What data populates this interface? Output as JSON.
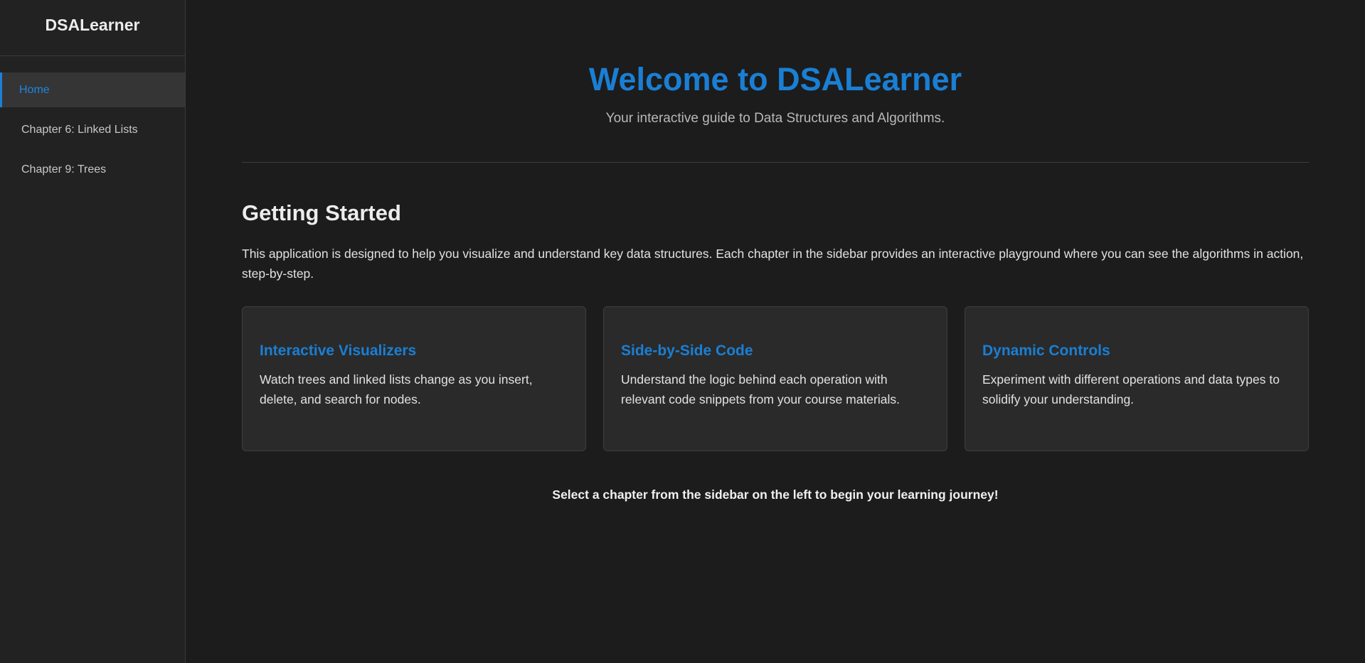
{
  "sidebar": {
    "brand": "DSALearner",
    "items": [
      {
        "label": "Home",
        "active": true
      },
      {
        "label": "Chapter 6: Linked Lists",
        "active": false
      },
      {
        "label": "Chapter 9: Trees",
        "active": false
      }
    ]
  },
  "hero": {
    "title": "Welcome to DSALearner",
    "subtitle": "Your interactive guide to Data Structures and Algorithms."
  },
  "getting_started": {
    "title": "Getting Started",
    "intro": "This application is designed to help you visualize and understand key data structures. Each chapter in the sidebar provides an interactive playground where you can see the algorithms in action, step-by-step."
  },
  "cards": [
    {
      "title": "Interactive Visualizers",
      "description": "Watch trees and linked lists change as you insert, delete, and search for nodes."
    },
    {
      "title": "Side-by-Side Code",
      "description": "Understand the logic behind each operation with relevant code snippets from your course materials."
    },
    {
      "title": "Dynamic Controls",
      "description": "Experiment with different operations and data types to solidify your understanding."
    }
  ],
  "cta": "Select a chapter from the sidebar on the left to begin your learning journey!",
  "colors": {
    "accent": "#1a7fd4",
    "background": "#1c1c1c",
    "sidebar": "#222222",
    "card": "#2a2a2a"
  }
}
